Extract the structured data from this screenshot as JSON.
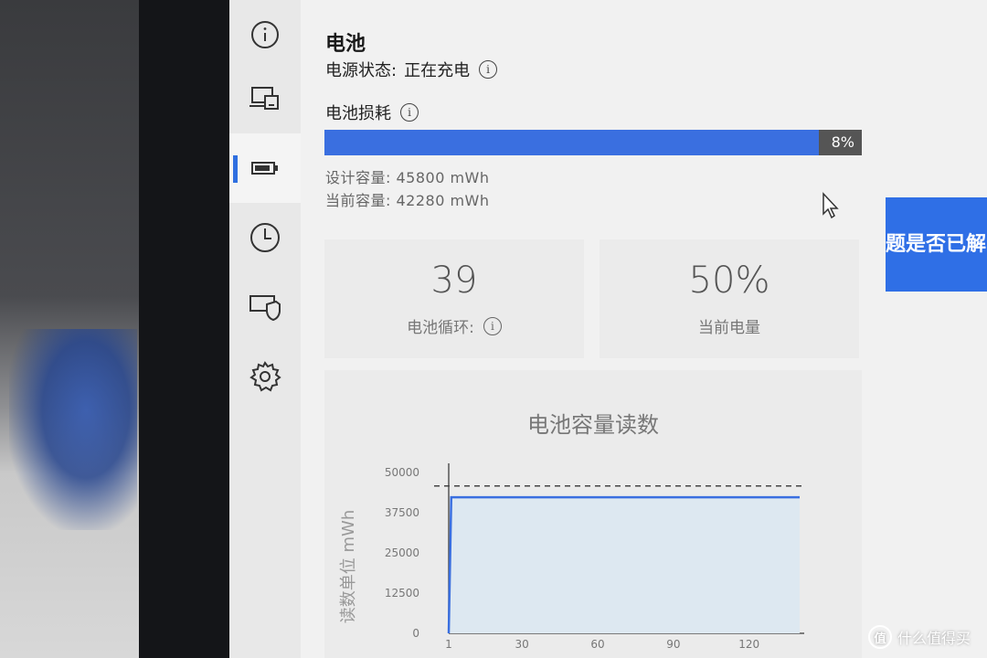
{
  "sidebar": {
    "items": [
      {
        "icon": "info-icon",
        "active": false
      },
      {
        "icon": "devices-icon",
        "active": false
      },
      {
        "icon": "battery-icon",
        "active": true
      },
      {
        "icon": "clock-icon",
        "active": false
      },
      {
        "icon": "shield-device-icon",
        "active": false
      },
      {
        "icon": "gear-icon",
        "active": false
      }
    ]
  },
  "battery": {
    "title": "电池",
    "power_state_label": "电源状态:",
    "power_state_value": "正在充电",
    "wear_label": "电池损耗",
    "wear_percent": 8,
    "wear_percent_text": "8%",
    "design_capacity": "设计容量:  45800  mWh",
    "current_capacity": "当前容量:  42280  mWh"
  },
  "cards": {
    "cycles_value": "39",
    "cycles_label": "电池循环:",
    "charge_value": "50%",
    "charge_label": "当前电量"
  },
  "banner": {
    "text": "题是否已解"
  },
  "watermark": {
    "icon_glyph": "值",
    "text": "什么值得买"
  },
  "colors": {
    "accent": "#3a6fe0",
    "banner": "#2f6fe6"
  },
  "chart_data": {
    "type": "area",
    "title": "电池容量读数",
    "ylabel": "读数单位 mWh",
    "xlabel": "",
    "x_ticks": [
      "1",
      "30",
      "60",
      "90",
      "120"
    ],
    "y_ticks": [
      "50000",
      "37500",
      "25000",
      "12500",
      "0"
    ],
    "ylim": [
      0,
      50000
    ],
    "reference_line": 45800,
    "series": [
      {
        "x": [
          1,
          2,
          40,
          80,
          140
        ],
        "y": [
          0,
          42280,
          42280,
          42280,
          42280
        ]
      }
    ]
  }
}
